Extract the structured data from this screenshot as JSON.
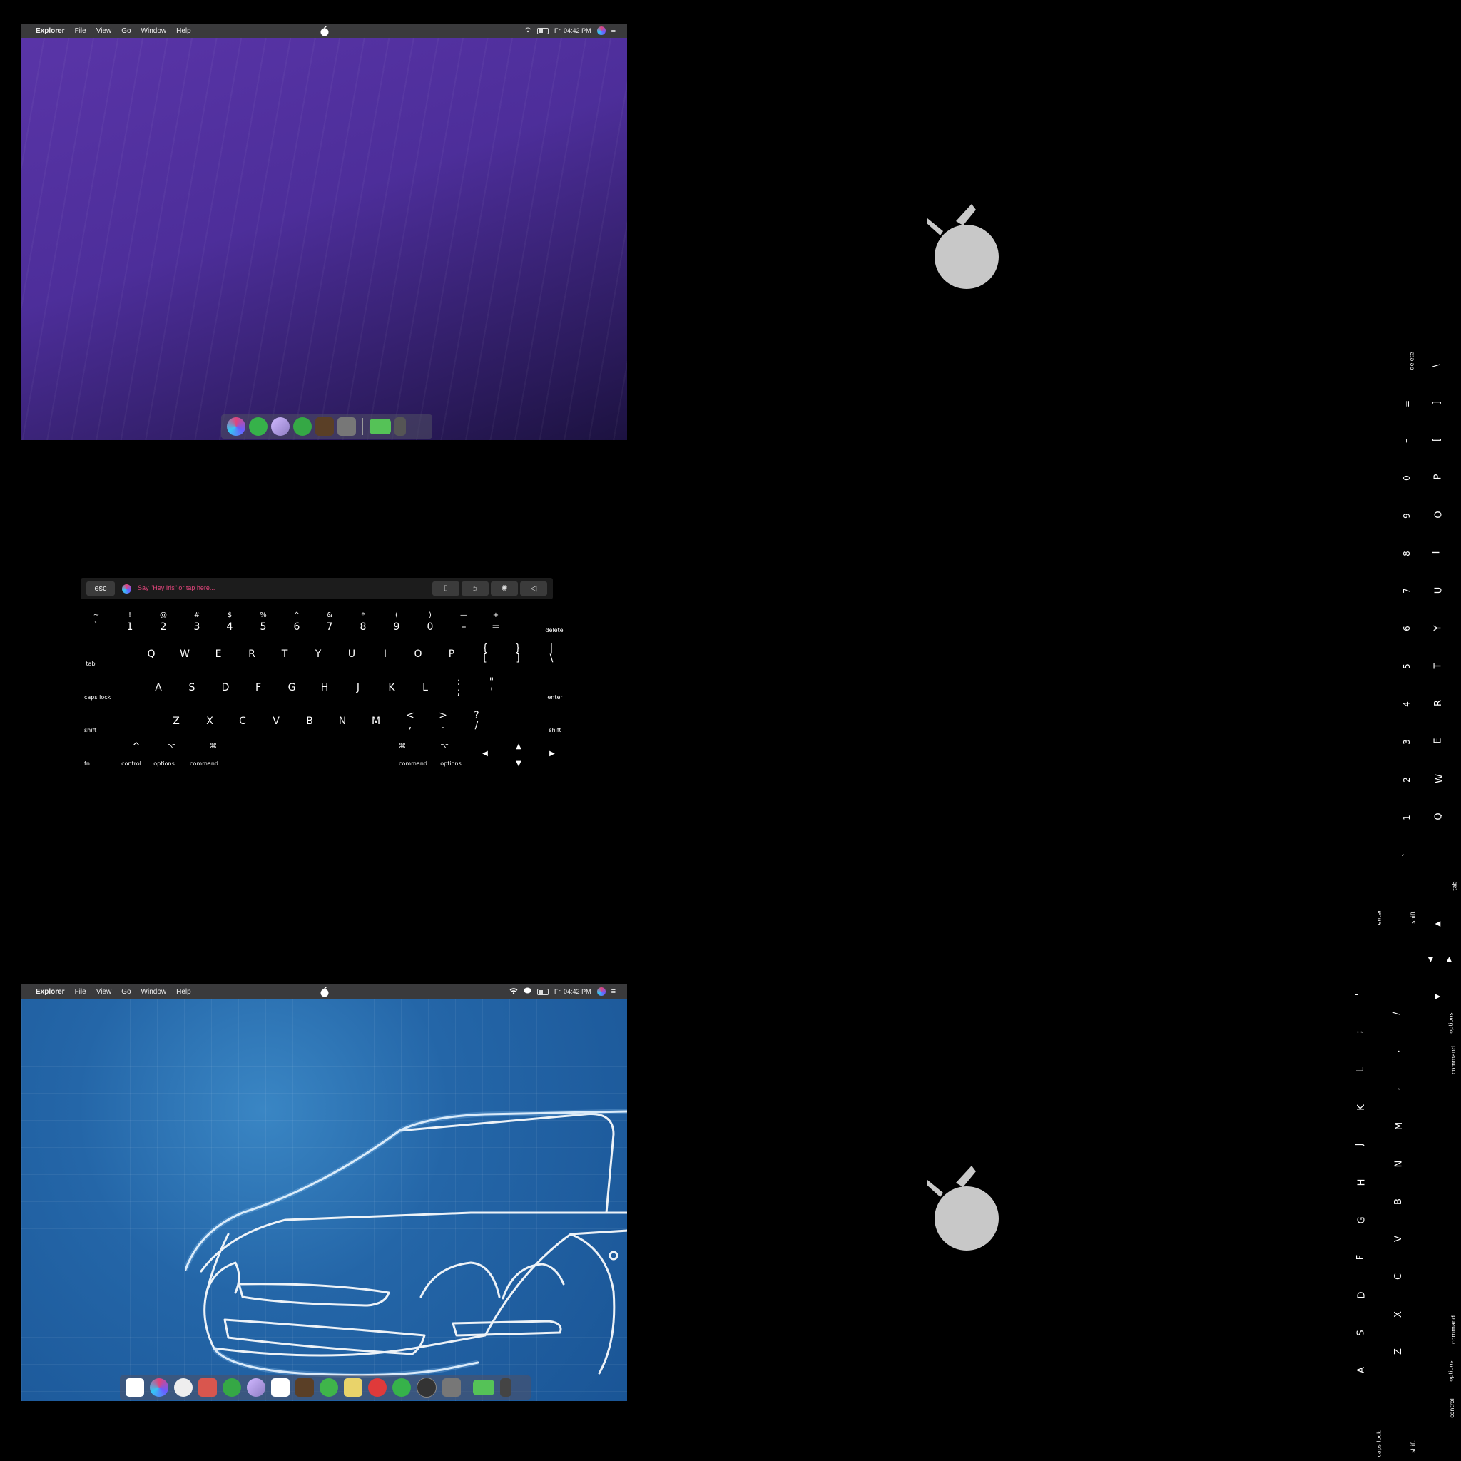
{
  "menubar": {
    "app": "Explorer",
    "items": [
      "File",
      "View",
      "Go",
      "Window",
      "Help"
    ],
    "time": "Fri 04:42 PM"
  },
  "touchbar": {
    "esc": "esc",
    "prompt": "Say \"Hey Iris\" or tap here..."
  },
  "keyboard": {
    "numrow_shift": [
      "~",
      "!",
      "@",
      "#",
      "$",
      "%",
      "^",
      "&",
      "*",
      "(",
      ")",
      "—",
      "+"
    ],
    "numrow": [
      "`",
      "1",
      "2",
      "3",
      "4",
      "5",
      "6",
      "7",
      "8",
      "9",
      "0",
      "–",
      "="
    ],
    "delete": "delete",
    "tab": "tab",
    "qrow": [
      "Q",
      "W",
      "E",
      "R",
      "T",
      "Y",
      "U",
      "I",
      "O",
      "P"
    ],
    "qrow_sym_shift": [
      "{",
      "}",
      "|"
    ],
    "qrow_sym": [
      "[",
      "]",
      "\\"
    ],
    "capslock": "caps lock",
    "arow": [
      "A",
      "S",
      "D",
      "F",
      "G",
      "H",
      "J",
      "K",
      "L"
    ],
    "arow_sym_shift": [
      ":",
      "\""
    ],
    "arow_sym": [
      ";",
      "'"
    ],
    "enter": "enter",
    "shift": "shift",
    "zrow": [
      "Z",
      "X",
      "C",
      "V",
      "B",
      "N",
      "M"
    ],
    "zrow_sym_shift": [
      "<",
      ">",
      "?"
    ],
    "zrow_sym": [
      ",",
      ".",
      "/"
    ],
    "fn": "fn",
    "control": "control",
    "options": "options",
    "command": "command",
    "arrows": {
      "up": "▲",
      "down": "▼",
      "left": "◀",
      "right": "▶"
    }
  },
  "icons": {
    "control": "^",
    "options": "⌥",
    "command": "⌘"
  }
}
